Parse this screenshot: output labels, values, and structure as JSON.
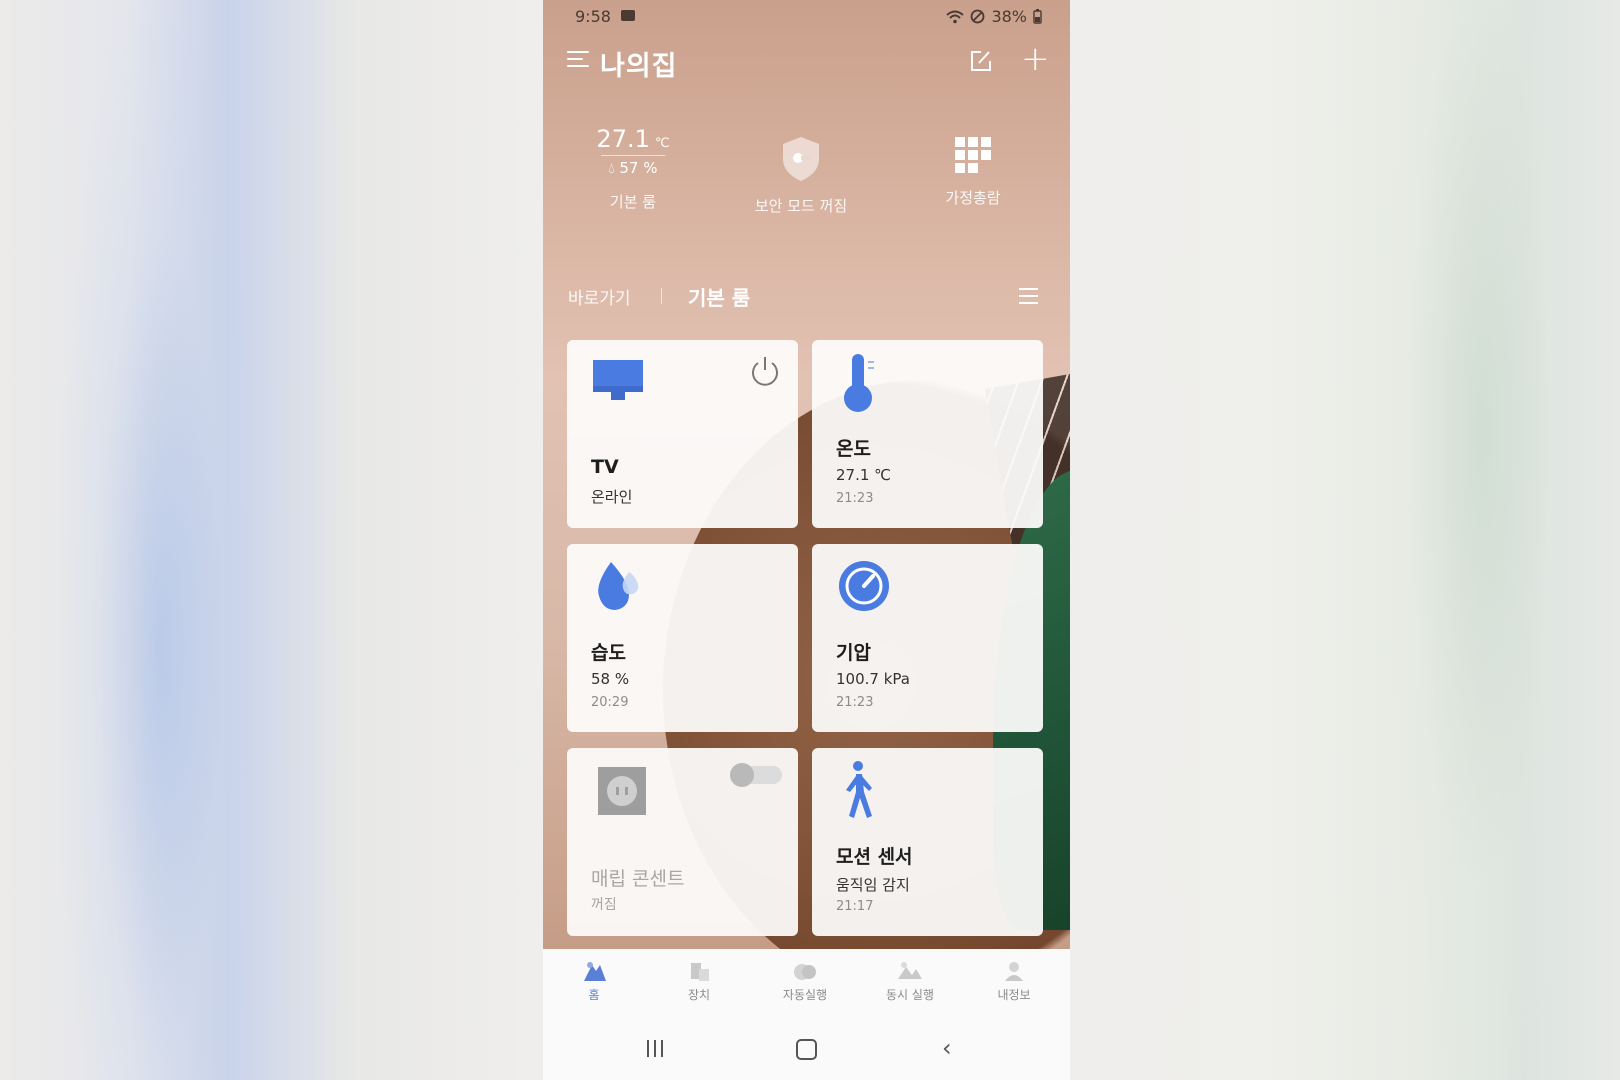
{
  "status": {
    "time": "9:58",
    "battery": "38%"
  },
  "header": {
    "title": "나의집"
  },
  "summary": {
    "temp": "27.1",
    "temp_unit": "℃",
    "humidity": "57 %",
    "temp_label": "기본 룸",
    "security_label": "보안 모드 꺼짐",
    "home_label": "가정총람"
  },
  "tabs": {
    "shortcut": "바로가기",
    "room": "기본 룸"
  },
  "cards": [
    {
      "name": "TV",
      "status": "온라인"
    },
    {
      "name": "온도",
      "value": "27.1 ℃",
      "time": "21:23"
    },
    {
      "name": "습도",
      "value": "58 %",
      "time": "20:29"
    },
    {
      "name": "기압",
      "value": "100.7 kPa",
      "time": "21:23"
    },
    {
      "name": "매립 콘센트",
      "status": "꺼짐"
    },
    {
      "name": "모션 센서",
      "status": "움직임 감지",
      "time": "21:17"
    }
  ],
  "nav": [
    {
      "label": "홈",
      "icon": "home-icon"
    },
    {
      "label": "장치",
      "icon": "device-icon"
    },
    {
      "label": "자동실행",
      "icon": "automation-icon"
    },
    {
      "label": "동시 실행",
      "icon": "scene-icon"
    },
    {
      "label": "내정보",
      "icon": "profile-icon"
    }
  ],
  "colors": {
    "accent": "#5a7fd6",
    "icon_blue": "#4a7be0",
    "card_bg": "#fcfbfa"
  }
}
